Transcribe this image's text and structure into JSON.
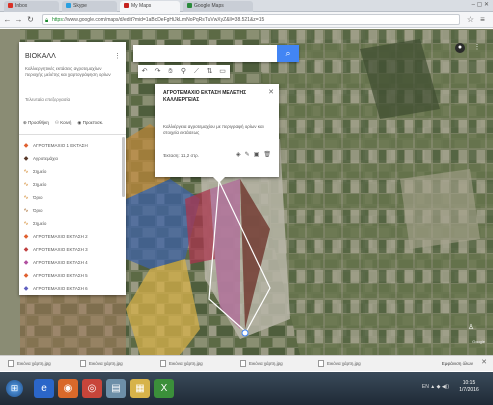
{
  "browser": {
    "tabs": [
      {
        "label": "Inbox",
        "active": false,
        "color": "#d93025"
      },
      {
        "label": "Skype",
        "active": false,
        "color": "#2aa0e0"
      },
      {
        "label": "My Maps",
        "active": true,
        "color": "#c5221f"
      },
      {
        "label": "Google Maps",
        "active": false,
        "color": "#2a8a3a"
      }
    ],
    "url_scheme": "https",
    "url_rest": "://www.google.com/maps/d/edit?mid=1aBcDeFgHiJkLmNoPqRsTuVwXyZ&ll=38.521&z=15"
  },
  "search": {
    "placeholder": ""
  },
  "panel": {
    "title": "ΒΙΟΚΑΛΛ",
    "description": "Καλλιεργητικές εκτάσεις αγροτεμαχίων περιοχής μελέτης και χαρτογράφηση ορίων",
    "subtitle": "Τελευταία επεξεργασία",
    "actions": [
      "Προσθήκη",
      "Κοινή",
      "Προεπισκ."
    ],
    "layers": [
      {
        "label": "ΑΓΡΟΤΕΜΑΧΙΟ 1 ΕΚΤΑΣΗ",
        "icon": "polygon",
        "color": "#e06030"
      },
      {
        "label": "Αγροτεμάχιο",
        "icon": "polygon",
        "color": "#5a3a2a"
      },
      {
        "label": "Σημείο",
        "icon": "line",
        "color": "#d08020"
      },
      {
        "label": "Σημείο",
        "icon": "line",
        "color": "#d08020"
      },
      {
        "label": "Όριο",
        "icon": "line",
        "color": "#d08020"
      },
      {
        "label": "Όριο",
        "icon": "line",
        "color": "#a06020"
      },
      {
        "label": "Σημείο",
        "icon": "line",
        "color": "#d08020"
      },
      {
        "label": "ΑΓΡΟΤΕΜΑΧΙΟ ΕΚΤΑΣΗ 2",
        "icon": "polygon",
        "color": "#e06030"
      },
      {
        "label": "ΑΓΡΟΤΕΜΑΧΙΟ ΕΚΤΑΣΗ 3",
        "icon": "polygon",
        "color": "#c04040"
      },
      {
        "label": "ΑΓΡΟΤΕΜΑΧΙΟ ΕΚΤΑΣΗ 4",
        "icon": "polygon",
        "color": "#b050a0"
      },
      {
        "label": "ΑΓΡΟΤΕΜΑΧΙΟ ΕΚΤΑΣΗ 5",
        "icon": "polygon",
        "color": "#e06030"
      },
      {
        "label": "ΑΓΡΟΤΕΜΑΧΙΟ ΕΚΤΑΣΗ 6",
        "icon": "polygon",
        "color": "#6060c0"
      }
    ]
  },
  "popup": {
    "title": "ΑΓΡΟΤΕΜΑΧΙΟ ΕΚΤΑΣΗ ΜΕΛΕΤΗΣ ΚΑΛΛΙΕΡΓΕΙΑΣ",
    "description": "Καλλιέργεια αγροτεμαχίου με περιγραφή ορίων και στοιχεία εκτάσεως",
    "footer": "Έκταση: 11,2 στρ."
  },
  "downloads": {
    "items": [
      "Εικόνα χάρτη.jpg",
      "Εικόνα χάρτη.jpg",
      "Εικόνα χάρτη.jpg",
      "Εικόνα χάρτη.jpg",
      "Εικόνα χάρτη.jpg"
    ],
    "show_all": "Εμφάνιση όλων"
  },
  "taskbar": {
    "tray": "EN  ▲  ◆  ◀))",
    "time": "10:15",
    "date": "1/7/2016"
  }
}
